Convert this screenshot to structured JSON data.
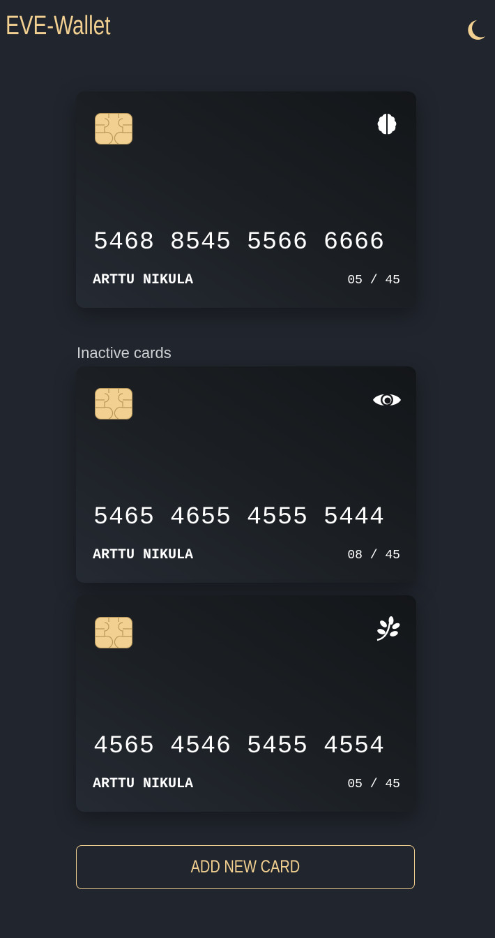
{
  "header": {
    "title": "EVE-Wallet",
    "theme_icon": "moon-icon"
  },
  "accent_color": "#f2d091",
  "active_card": {
    "number": "5468 8545 5566 6666",
    "holder": "ARTTU NIKULA",
    "expiry": "05 / 45",
    "icon": "brain-icon"
  },
  "inactive_label": "Inactive cards",
  "inactive_cards": [
    {
      "number": "5465 4655 4555 5444",
      "holder": "ARTTU NIKULA",
      "expiry": "08 / 45",
      "icon": "eye-icon"
    },
    {
      "number": "4565 4546 5455 4554",
      "holder": "ARTTU NIKULA",
      "expiry": "05 / 45",
      "icon": "leaf-icon"
    }
  ],
  "add_button": "ADD NEW CARD"
}
